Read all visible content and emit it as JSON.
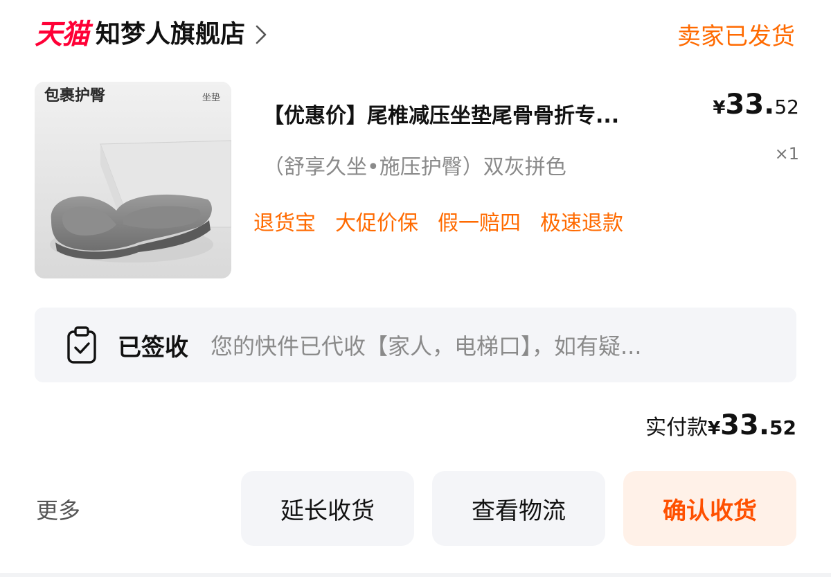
{
  "header": {
    "platform_logo": "天猫",
    "shop_name": "知梦人旗舰店",
    "order_status": "卖家已发货"
  },
  "product": {
    "image_tag": "包裹护臀",
    "image_small_text": "坐垫",
    "title": "【优惠价】尾椎减压坐垫尾骨骨折专...",
    "sku": "（舒享久坐•施压护臀）双灰拼色",
    "price": {
      "symbol": "¥",
      "integer": "33.",
      "decimal": "52"
    },
    "quantity": "×1",
    "services": [
      "退货宝",
      "大促价保",
      "假一赔四",
      "极速退款"
    ]
  },
  "logistics": {
    "icon": "clipboard-check-icon",
    "status": "已签收",
    "message": "您的快件已代收【家人，电梯口】，如有疑..."
  },
  "payment": {
    "label": "实付款",
    "symbol": "¥",
    "integer": "33.",
    "decimal": "52"
  },
  "actions": {
    "more": "更多",
    "extend_receipt": "延长收货",
    "view_logistics": "查看物流",
    "confirm_receipt": "确认收货"
  },
  "colors": {
    "brand_red": "#ff0036",
    "accent_orange": "#ff6a00",
    "confirm_bg": "#fff1e8",
    "panel_bg": "#f4f5f8"
  }
}
